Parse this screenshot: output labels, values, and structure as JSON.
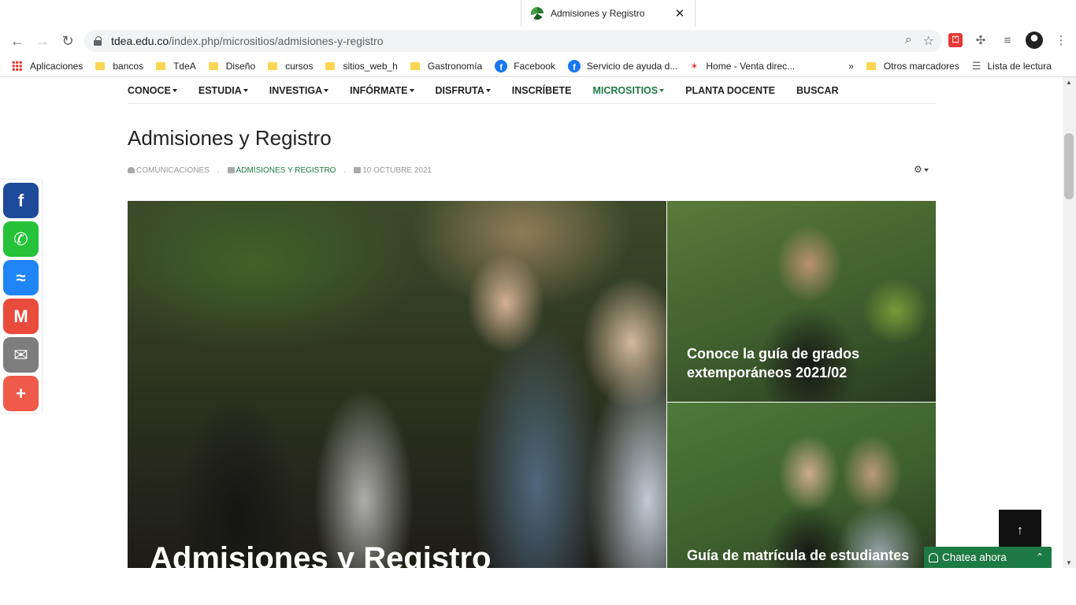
{
  "browser": {
    "tab_title": "Admisiones y Registro",
    "tab_close": "✕",
    "url_host": "tdea.edu.co",
    "url_path": "/index.php/micrositios/admisiones-y-registro",
    "back": "←",
    "forward": "→",
    "reload": "↻"
  },
  "bookmarks": {
    "apps": "Aplicaciones",
    "items": [
      "bancos",
      "TdeA",
      "Diseño",
      "cursos",
      "sitios_web_h",
      "Gastronomía",
      "Facebook",
      "Servicio de ayuda d...",
      "Home - Venta direc..."
    ],
    "more": "»",
    "other": "Otros marcadores",
    "reading_list": "Lista de lectura"
  },
  "site_nav": [
    {
      "label": "CONOCE",
      "caret": true
    },
    {
      "label": "ESTUDIA",
      "caret": true
    },
    {
      "label": "INVESTIGA",
      "caret": true
    },
    {
      "label": "INFÓRMATE",
      "caret": true
    },
    {
      "label": "DISFRUTA",
      "caret": true
    },
    {
      "label": "INSCRÍBETE",
      "caret": false
    },
    {
      "label": "MICROSITIOS",
      "caret": true,
      "active": true
    },
    {
      "label": "PLANTA DOCENTE",
      "caret": false
    },
    {
      "label": "BUSCAR",
      "caret": false
    }
  ],
  "article": {
    "title": "Admisiones y Registro",
    "author": "COMUNICACIONES",
    "category": "ADMISIONES Y REGISTRO",
    "date": "10 OCTUBRE 2021"
  },
  "hero": {
    "title": "Admisiones y Registro"
  },
  "cards": [
    {
      "title": "Conoce la guía de grados extemporáneos 2021/02"
    },
    {
      "title": "Guía de matrícula de estudiantes"
    }
  ],
  "share_buttons": [
    {
      "name": "facebook",
      "glyph": "f",
      "color": "#1e4a9a"
    },
    {
      "name": "whatsapp",
      "glyph": "✆",
      "color": "#25c23a"
    },
    {
      "name": "messenger",
      "glyph": "≈",
      "color": "#1f85f5"
    },
    {
      "name": "gmail",
      "glyph": "M",
      "color": "#e94b3c"
    },
    {
      "name": "email",
      "glyph": "✉",
      "color": "#7d7d7d"
    },
    {
      "name": "more",
      "glyph": "+",
      "color": "#ef5a4a"
    }
  ],
  "scroll_top": "↑",
  "chat": {
    "label": "Chatea ahora",
    "chevron": "⌃"
  },
  "colors": {
    "brand_green": "#1e7a45"
  }
}
